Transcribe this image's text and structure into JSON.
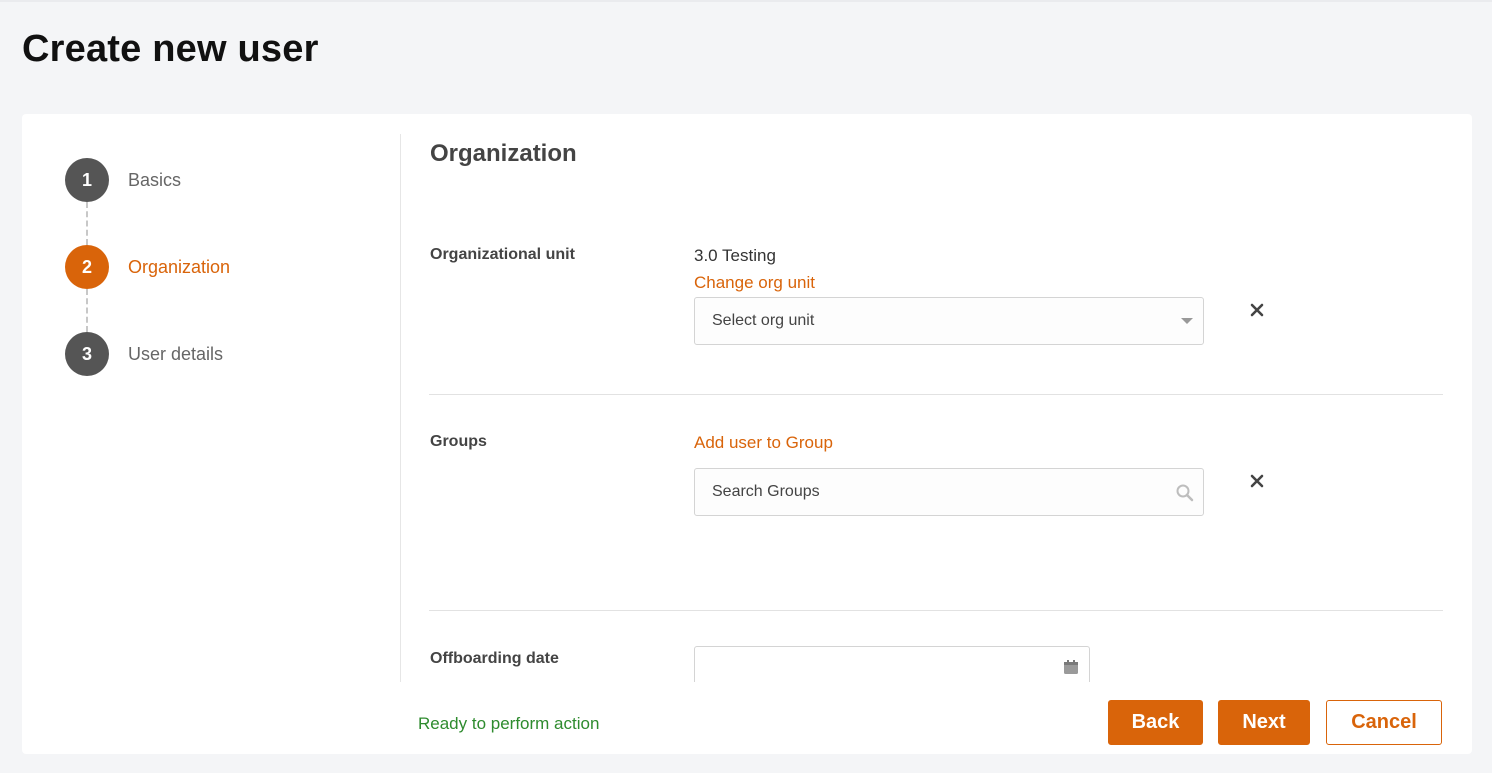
{
  "page": {
    "title": "Create new user"
  },
  "stepper": {
    "steps": [
      {
        "number": "1",
        "label": "Basics",
        "state": "complete"
      },
      {
        "number": "2",
        "label": "Organization",
        "state": "active"
      },
      {
        "number": "3",
        "label": "User details",
        "state": "pending"
      }
    ]
  },
  "section": {
    "title": "Organization"
  },
  "org_unit": {
    "label": "Organizational unit",
    "current_value": "3.0 Testing",
    "change_link": "Change org unit",
    "select_placeholder": "Select org unit",
    "clear_icon": "close-icon"
  },
  "groups": {
    "label": "Groups",
    "add_link": "Add user to Group",
    "search_placeholder": "Search Groups",
    "clear_icon": "close-icon"
  },
  "offboarding": {
    "label": "Offboarding date",
    "value": "",
    "icon": "calendar-icon"
  },
  "footer": {
    "status": "Ready to perform action",
    "back_label": "Back",
    "next_label": "Next",
    "cancel_label": "Cancel"
  },
  "colors": {
    "accent": "#d9640a",
    "step_inactive": "#555555",
    "status_ok": "#2e8b2e",
    "background": "#f4f5f7"
  }
}
